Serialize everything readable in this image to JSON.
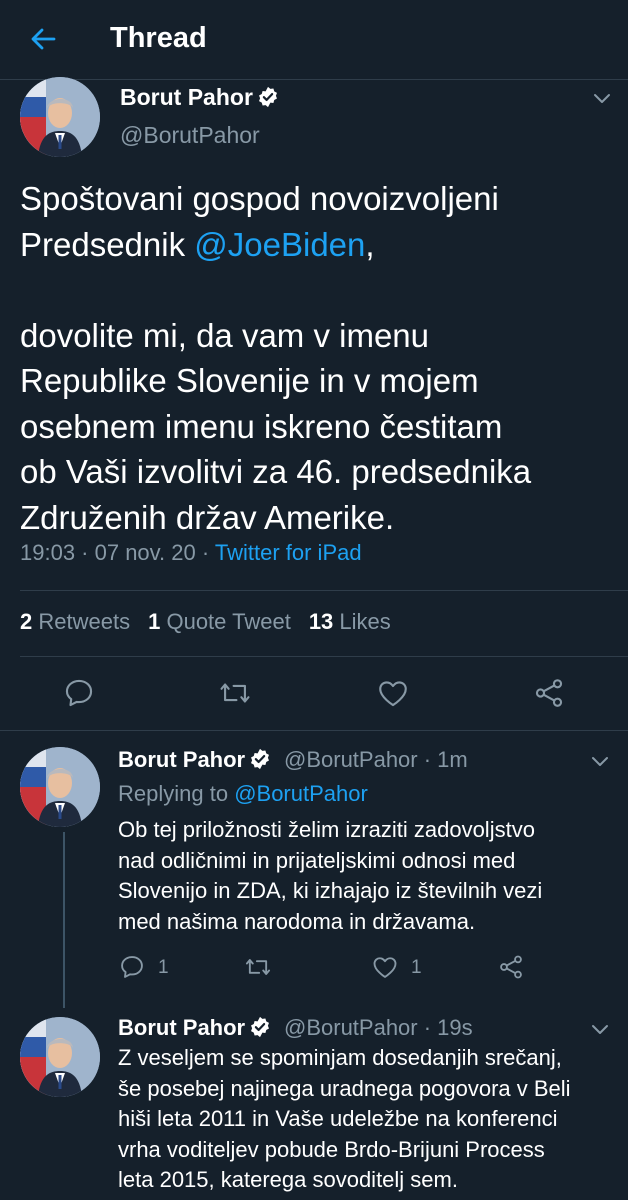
{
  "header": {
    "title": "Thread"
  },
  "main_tweet": {
    "name": "Borut Pahor",
    "handle": "@BorutPahor",
    "text_line_1": "Spoštovani gospod novoizvoljeni",
    "text_line_2_prefix": "Predsednik ",
    "text_line_2_mention": "@JoeBiden",
    "text_line_2_suffix": ",",
    "text_line_3": "dovolite mi, da vam v imenu",
    "text_line_4": "Republike Slovenije in v mojem",
    "text_line_5": "osebnem imenu iskreno čestitam",
    "text_line_6": "ob Vaši izvolitvi za 46. predsednika",
    "text_line_7": "Združenih držav Amerike.",
    "timestamp": "19:03 · 07 nov. 20 · ",
    "source": "Twitter for iPad",
    "stats": {
      "retweets_count": "2",
      "retweets_label": "Retweets",
      "quotes_count": "1",
      "quotes_label": "Quote Tweet",
      "likes_count": "13",
      "likes_label": "Likes"
    }
  },
  "replies": [
    {
      "name": "Borut Pahor",
      "handle_time": "@BorutPahor · 1m",
      "replying_label": "Replying to ",
      "replying_handle": "@BorutPahor",
      "lines": [
        "Ob tej priložnosti želim izraziti zadovoljstvo",
        "nad odličnimi in prijateljskimi odnosi med",
        "Slovenijo in ZDA, ki izhajajo iz številnih vezi",
        "med našima narodoma in državama."
      ],
      "reply_count": "1",
      "like_count": "1"
    },
    {
      "name": "Borut Pahor",
      "handle_time": "@BorutPahor · 19s",
      "lines": [
        "Z veseljem se spominjam dosedanjih srečanj,",
        "še posebej najinega uradnega pogovora v Beli",
        "hiši leta 2011 in Vaše udeležbe na konferenci",
        "vrha voditeljev pobude Brdo-Brijuni Process",
        "leta 2015, katerega sovoditelj sem."
      ]
    }
  ],
  "colors": {
    "background": "#15202b",
    "accent": "#1da1f2",
    "secondary_text": "#8899a6",
    "divider": "#2f3d4a"
  }
}
